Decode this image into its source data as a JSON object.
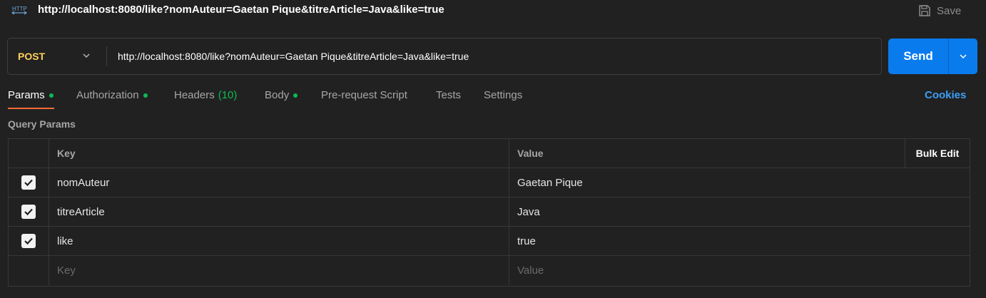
{
  "titlebar": {
    "icon": "http-icon",
    "title": "http://localhost:8080/like?nomAuteur=Gaetan Pique&titreArticle=Java&like=true",
    "save_label": "Save"
  },
  "request": {
    "method": "POST",
    "url": "http://localhost:8080/like?nomAuteur=Gaetan Pique&titreArticle=Java&like=true",
    "send_label": "Send"
  },
  "tabs": [
    {
      "label": "Params",
      "dot": true,
      "active": true
    },
    {
      "label": "Authorization",
      "dot": true
    },
    {
      "label": "Headers",
      "count": "(10)"
    },
    {
      "label": "Body",
      "dot": true
    },
    {
      "label": "Pre-request Script"
    },
    {
      "label": "Tests"
    },
    {
      "label": "Settings"
    }
  ],
  "cookies_label": "Cookies",
  "query_params": {
    "section_label": "Query Params",
    "columns": {
      "key": "Key",
      "value": "Value",
      "bulk_edit": "Bulk Edit"
    },
    "rows": [
      {
        "checked": true,
        "key": "nomAuteur",
        "value": "Gaetan Pique"
      },
      {
        "checked": true,
        "key": "titreArticle",
        "value": "Java"
      },
      {
        "checked": true,
        "key": "like",
        "value": "true"
      }
    ],
    "new_row": {
      "key_placeholder": "Key",
      "value_placeholder": "Value"
    }
  },
  "colors": {
    "background": "#212121",
    "method": "#ffd15c",
    "send": "#097bed",
    "active_tab_underline": "#ff6c37",
    "status_dot": "#0cbb52",
    "cookies": "#3d9ff5"
  }
}
